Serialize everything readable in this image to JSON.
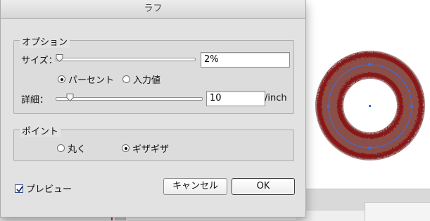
{
  "dialog": {
    "title": "ラフ",
    "options_group": {
      "legend": "オプション",
      "size_label": "サイズ：",
      "size_value": "2%",
      "size_slider_fraction": 0.03,
      "unit_radio_percent": "パーセント",
      "unit_radio_absolute": "入力値",
      "unit_selected": "percent",
      "detail_label": "詳細：",
      "detail_value": "10",
      "detail_slider_fraction": 0.1,
      "detail_unit": "/inch"
    },
    "points_group": {
      "legend": "ポイント",
      "radio_smooth": "丸く",
      "radio_corner": "ギザギザ",
      "selected": "corner"
    },
    "preview_label": "プレビュー",
    "preview_checked": true,
    "cancel_label": "キャンセル",
    "ok_label": "OK"
  },
  "colors": {
    "artwork_fill": "#8a5048",
    "artwork_edge": "#8b1616",
    "path_selection": "#3b6fe0"
  }
}
